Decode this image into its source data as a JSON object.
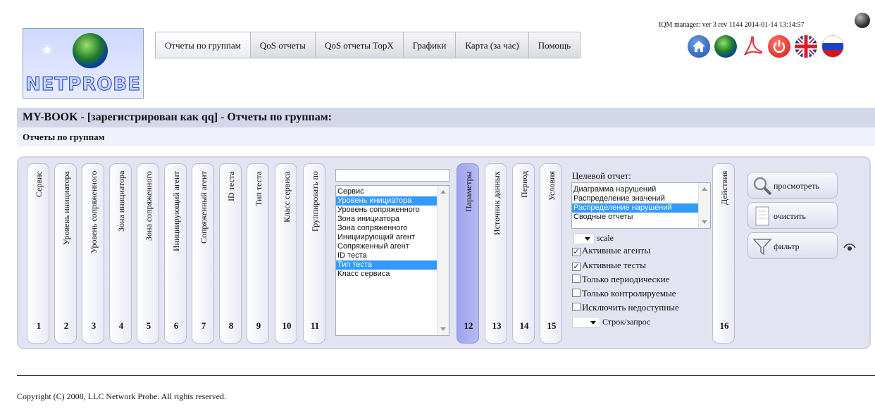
{
  "header": {
    "logo_text": "NETPROBE",
    "version_text": "IQM manager: ver 3 rev 1144 2014-01-14 13:14:57"
  },
  "menu": {
    "items": [
      {
        "label": "Отчеты по группам",
        "active": true
      },
      {
        "label": "QoS отчеты"
      },
      {
        "label": "QoS отчеты TopX"
      },
      {
        "label": "Графики"
      },
      {
        "label": "Карта (за час)"
      },
      {
        "label": "Помощь"
      }
    ]
  },
  "icons": [
    "home-icon",
    "globe-icon",
    "pdf-icon",
    "power-icon",
    "uk-flag-icon",
    "russia-flag-icon"
  ],
  "title_bar": "MY-BOOK - [зарегистрирован как qq] - Отчеты по группам:",
  "subtitle_bar": "Отчеты по группам",
  "tabs": [
    {
      "label": "Сервис",
      "number": "1"
    },
    {
      "label": "Уровень инициатора",
      "number": "2"
    },
    {
      "label": "Уровень сопряженного",
      "number": "3"
    },
    {
      "label": "Зона инициатора",
      "number": "4"
    },
    {
      "label": "Зона сопряженного",
      "number": "5"
    },
    {
      "label": "Инициирующий агент",
      "number": "6"
    },
    {
      "label": "Сопряженный агент",
      "number": "7"
    },
    {
      "label": "ID теста",
      "number": "8"
    },
    {
      "label": "Тип теста",
      "number": "9"
    },
    {
      "label": "Класс сервиса",
      "number": "10"
    },
    {
      "label": "Группировать по",
      "number": "11"
    },
    {
      "label": "Параметры",
      "number": "12",
      "selected": true
    },
    {
      "label": "Источник данных",
      "number": "13"
    },
    {
      "label": "Период",
      "number": "14"
    },
    {
      "label": "Условия",
      "number": "15"
    },
    {
      "label": "Действия",
      "number": "16"
    }
  ],
  "group_list": {
    "input_value": "",
    "options": [
      {
        "label": "Сервис",
        "highlighted": false
      },
      {
        "label": "Уровень инициатора",
        "highlighted": true
      },
      {
        "label": "Уровень сопряженного",
        "highlighted": false
      },
      {
        "label": "Зона инициатора",
        "highlighted": false
      },
      {
        "label": "Зона сопряженного",
        "highlighted": false
      },
      {
        "label": "Инициирующий агент",
        "highlighted": false
      },
      {
        "label": "Сопряженный агент",
        "highlighted": false
      },
      {
        "label": "ID теста",
        "highlighted": false
      },
      {
        "label": "Тип теста",
        "highlighted": true
      },
      {
        "label": "Класс сервиса",
        "highlighted": false
      }
    ]
  },
  "target": {
    "label": "Целевой отчет:",
    "options": [
      {
        "label": "Диаграмма нарушений",
        "highlighted": false
      },
      {
        "label": "Распределение значений",
        "highlighted": false
      },
      {
        "label": "Распределение нарушений",
        "highlighted": true
      },
      {
        "label": "Сводные отчеты",
        "highlighted": false
      }
    ]
  },
  "scale_label": "scale",
  "checkboxes": [
    {
      "label": "Активные агенты",
      "checked": true
    },
    {
      "label": "Активные тесты",
      "checked": true
    },
    {
      "label": "Только периодические",
      "checked": false
    },
    {
      "label": "Только контролируемые",
      "checked": false
    },
    {
      "label": "Исключить недоступные",
      "checked": false
    }
  ],
  "rows_label": "Строк/запрос",
  "actions": {
    "view": "просмотреть",
    "clear": "очистить",
    "filter": "фильтр"
  },
  "footer": "Copyright (C) 2008, LLC Network Probe. All rights reserved.",
  "colors": {
    "title_bar": "#d4d6ea",
    "panel": "#e3e4f1",
    "selected_tab": "#9ea4ec",
    "list_highlight": "#3399ff"
  }
}
